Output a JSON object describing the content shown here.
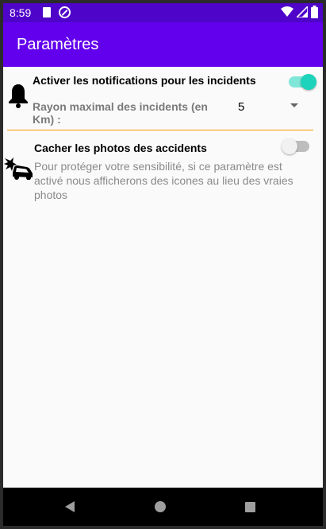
{
  "statusbar": {
    "time": "8:59",
    "icons": [
      "sd-card-icon",
      "do-not-disturb-icon",
      "wifi-icon",
      "signal-icon",
      "battery-icon"
    ]
  },
  "appbar": {
    "title": "Paramètres",
    "color": "#6200ee"
  },
  "settings": {
    "notifications": {
      "label": "Activer les notifications pour les incidents",
      "enabled": true,
      "icon": "bell-icon"
    },
    "radius": {
      "label": "Rayon maximal des incidents (en Km) :",
      "value": "5"
    },
    "hide_photos": {
      "label": "Cacher les photos des accidents",
      "description": "Pour protéger votre sensibilité, si ce paramètre est activé nous afficherons des icones au lieu des vraies photos",
      "enabled": false,
      "icon": "car-crash-icon"
    }
  },
  "colors": {
    "accent": "#1dd3bb",
    "divider": "#ff9800",
    "statusbar": "#4f04c9"
  },
  "navbar": {
    "icons": [
      "back-icon",
      "home-icon",
      "recents-icon"
    ]
  }
}
